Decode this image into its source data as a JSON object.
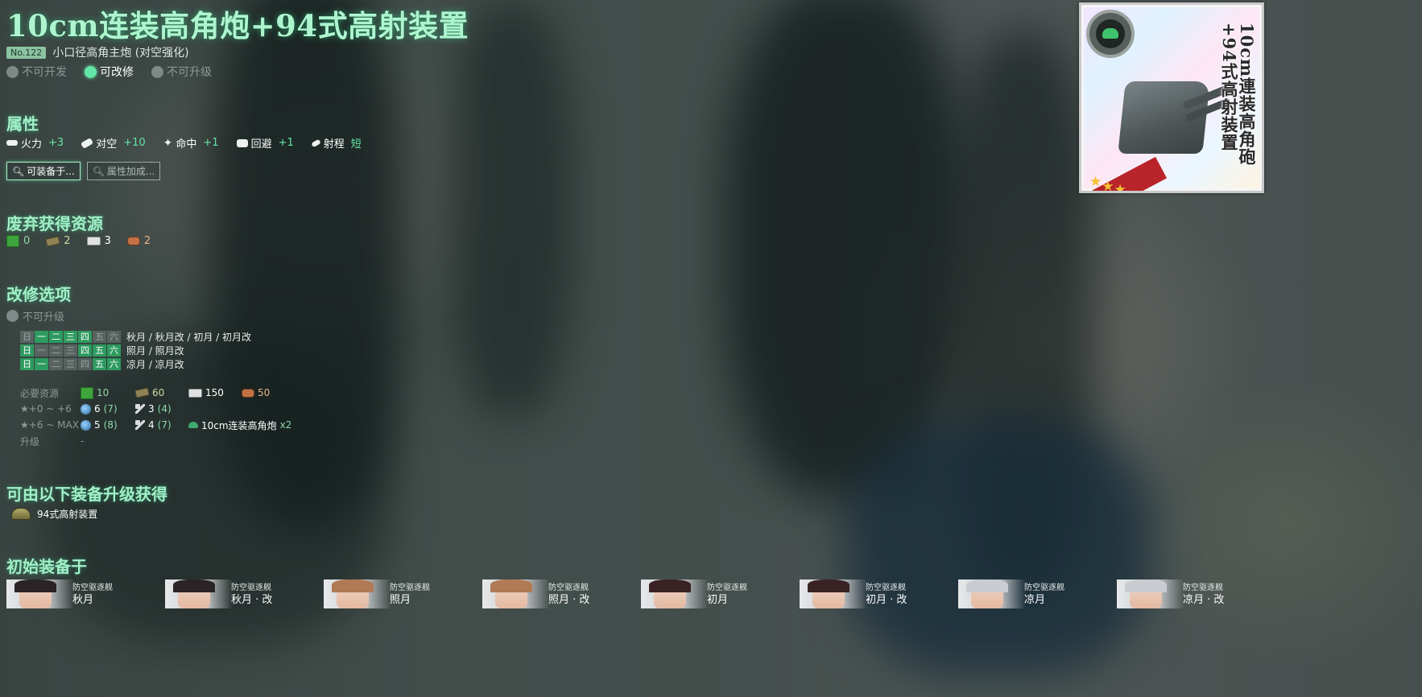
{
  "equipment": {
    "name": "10cm连装高角炮+94式高射装置",
    "number": "No.122",
    "category": "小口径高角主炮 (对空强化)"
  },
  "status": [
    {
      "label": "不可开发",
      "active": false
    },
    {
      "label": "可改修",
      "active": true
    },
    {
      "label": "不可升级",
      "active": false
    }
  ],
  "sections": {
    "stats": "属性",
    "scrap": "废弃获得资源",
    "improvement": "改修选项",
    "upgrade_from": "可由以下装备升级获得",
    "initial": "初始装备于"
  },
  "stats": [
    {
      "icon": "firepower-icon",
      "label": "火力",
      "value": "+3"
    },
    {
      "icon": "anti-air-icon",
      "label": "对空",
      "value": "+10"
    },
    {
      "icon": "accuracy-icon",
      "label": "命中",
      "value": "+1"
    },
    {
      "icon": "evasion-icon",
      "label": "回避",
      "value": "+1"
    },
    {
      "icon": "range-icon",
      "label": "射程",
      "value": "短"
    }
  ],
  "buttons": {
    "equippable": "可装备于...",
    "bonus": "属性加成..."
  },
  "scrap": {
    "fuel": "0",
    "ammo": "2",
    "steel": "3",
    "bauxite": "2"
  },
  "improvement": {
    "note": "不可升级",
    "schedule": [
      {
        "days": [
          "日",
          "一",
          "二",
          "三",
          "四",
          "五",
          "六"
        ],
        "on": [
          false,
          true,
          true,
          true,
          true,
          false,
          false
        ],
        "ships": "秋月 / 秋月改 / 初月 / 初月改"
      },
      {
        "days": [
          "日",
          "一",
          "二",
          "三",
          "四",
          "五",
          "六"
        ],
        "on": [
          true,
          false,
          false,
          false,
          true,
          true,
          true
        ],
        "ships": "照月 / 照月改"
      },
      {
        "days": [
          "日",
          "一",
          "二",
          "三",
          "四",
          "五",
          "六"
        ],
        "on": [
          true,
          true,
          false,
          false,
          false,
          true,
          true
        ],
        "ships": "凉月 / 凉月改"
      }
    ],
    "requirements": {
      "resources_label": "必要资源",
      "fuel": "10",
      "ammo": "60",
      "steel": "150",
      "bauxite": "50",
      "stage1_label": "★+0 ~ +6",
      "stage1_devmat": "6",
      "stage1_devmat_sure": "(7)",
      "stage1_screw": "3",
      "stage1_screw_sure": "(4)",
      "stage2_label": "★+6 ~ MAX",
      "stage2_devmat": "5",
      "stage2_devmat_sure": "(8)",
      "stage2_screw": "4",
      "stage2_screw_sure": "(7)",
      "stage2_equip": "10cm连装高角炮",
      "stage2_equip_count": "x2",
      "upgrade_label": "升级",
      "upgrade_value": "-"
    }
  },
  "upgrade_from": {
    "name": "94式高射装置"
  },
  "initial_ships": [
    {
      "type": "防空驱逐舰",
      "name": "秋月",
      "hair": "#2a2426"
    },
    {
      "type": "防空驱逐舰",
      "name": "秋月 · 改",
      "hair": "#2a2426"
    },
    {
      "type": "防空驱逐舰",
      "name": "照月",
      "hair": "#b07a55"
    },
    {
      "type": "防空驱逐舰",
      "name": "照月 · 改",
      "hair": "#b07a55"
    },
    {
      "type": "防空驱逐舰",
      "name": "初月",
      "hair": "#3a2224"
    },
    {
      "type": "防空驱逐舰",
      "name": "初月 · 改",
      "hair": "#3a2224"
    },
    {
      "type": "防空驱逐舰",
      "name": "凉月",
      "hair": "#c9ccd1"
    },
    {
      "type": "防空驱逐舰",
      "name": "凉月 · 改",
      "hair": "#c9ccd1"
    }
  ],
  "card": {
    "vertical_name": "10cm連装高角砲+94式高射装置",
    "stars": 3
  },
  "colors": {
    "accent": "#63e6a7",
    "title": "#aef5cf",
    "day_on": "#2e9a5f"
  }
}
